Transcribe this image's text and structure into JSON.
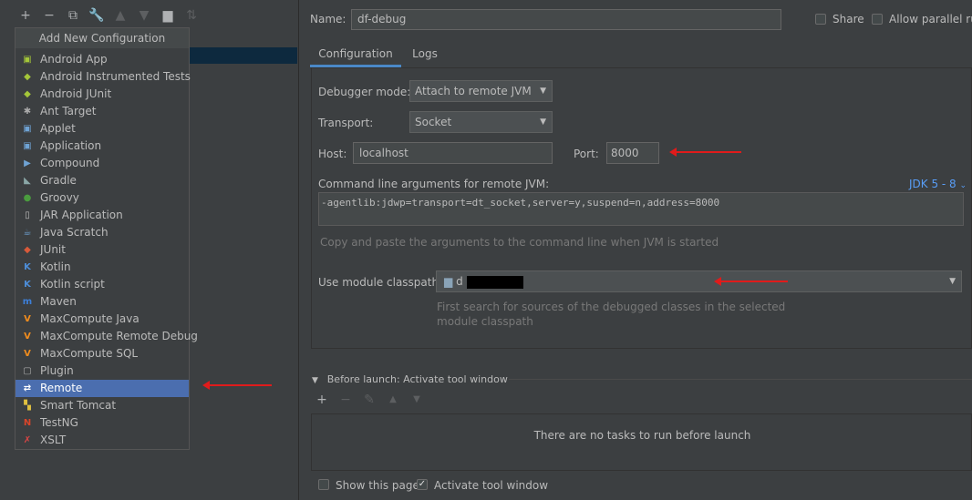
{
  "toolbar": {
    "icons": [
      "plus-icon",
      "minus-icon",
      "copy-icon",
      "wrench-icon",
      "arrow-up-icon",
      "arrow-down-icon",
      "folder-icon",
      "sort-icon"
    ]
  },
  "popup": {
    "title": "Add New Configuration",
    "items": [
      {
        "label": "Android App",
        "icon": "android-app-icon",
        "color": "#a4c639"
      },
      {
        "label": "Android Instrumented Tests",
        "icon": "android-tests-icon",
        "color": "#a4c639"
      },
      {
        "label": "Android JUnit",
        "icon": "android-junit-icon",
        "color": "#a4c639"
      },
      {
        "label": "Ant Target",
        "icon": "ant-icon",
        "color": "#aaaaaa"
      },
      {
        "label": "Applet",
        "icon": "applet-icon",
        "color": "#6fa3d4"
      },
      {
        "label": "Application",
        "icon": "application-icon",
        "color": "#6fa3d4"
      },
      {
        "label": "Compound",
        "icon": "compound-icon",
        "color": "#6fa3d4"
      },
      {
        "label": "Gradle",
        "icon": "gradle-icon",
        "color": "#8aa7a7"
      },
      {
        "label": "Groovy",
        "icon": "groovy-icon",
        "color": "#4a9c3e"
      },
      {
        "label": "JAR Application",
        "icon": "jar-icon",
        "color": "#bbbbbb"
      },
      {
        "label": "Java Scratch",
        "icon": "java-scratch-icon",
        "color": "#6fa3d4"
      },
      {
        "label": "JUnit",
        "icon": "junit-icon",
        "color": "#d95a3a"
      },
      {
        "label": "Kotlin",
        "icon": "kotlin-icon",
        "color": "#4d8ed9"
      },
      {
        "label": "Kotlin script",
        "icon": "kotlin-script-icon",
        "color": "#4d8ed9"
      },
      {
        "label": "Maven",
        "icon": "maven-icon",
        "color": "#3d7fd9"
      },
      {
        "label": "MaxCompute Java",
        "icon": "maxcompute-icon",
        "color": "#f08c1e"
      },
      {
        "label": "MaxCompute Remote Debug",
        "icon": "maxcompute-icon",
        "color": "#f08c1e"
      },
      {
        "label": "MaxCompute SQL",
        "icon": "maxcompute-icon",
        "color": "#f08c1e"
      },
      {
        "label": "Plugin",
        "icon": "plugin-icon",
        "color": "#aaaaaa"
      },
      {
        "label": "Remote",
        "icon": "remote-icon",
        "color": "#ffffff",
        "selected": true
      },
      {
        "label": "Smart Tomcat",
        "icon": "tomcat-icon",
        "color": "#e0c040"
      },
      {
        "label": "TestNG",
        "icon": "testng-icon",
        "color": "#d9452a"
      },
      {
        "label": "XSLT",
        "icon": "xslt-icon",
        "color": "#d94545"
      }
    ]
  },
  "name": {
    "label": "Name:",
    "value": "df-debug"
  },
  "share": {
    "label": "Share"
  },
  "parallel": {
    "label": "Allow parallel run"
  },
  "tabs": [
    {
      "label": "Configuration",
      "active": true
    },
    {
      "label": "Logs",
      "active": false
    }
  ],
  "debugger_mode": {
    "label": "Debugger mode:",
    "value": "Attach to remote JVM"
  },
  "transport": {
    "label": "Transport:",
    "value": "Socket"
  },
  "host": {
    "label": "Host:",
    "value": "localhost"
  },
  "port": {
    "label": "Port:",
    "value": "8000"
  },
  "cmdline": {
    "label": "Command line arguments for remote JVM:",
    "jdk": "JDK 5 - 8",
    "value": "-agentlib:jdwp=transport=dt_socket,server=y,suspend=n,address=8000",
    "hint": "Copy and paste the arguments to the command line when JVM is started"
  },
  "module": {
    "label": "Use module classpath:",
    "value": "d",
    "hint_line1": "First search for sources of the debugged classes in the selected",
    "hint_line2": "module classpath"
  },
  "before_launch": {
    "title": "Before launch: Activate tool window",
    "empty": "There are no tasks to run before launch"
  },
  "footer": {
    "show_page": "Show this page",
    "activate": "Activate tool window"
  },
  "colors": {
    "accent": "#4b6eaf",
    "arrow": "#e01b1b",
    "link": "#589df6"
  }
}
